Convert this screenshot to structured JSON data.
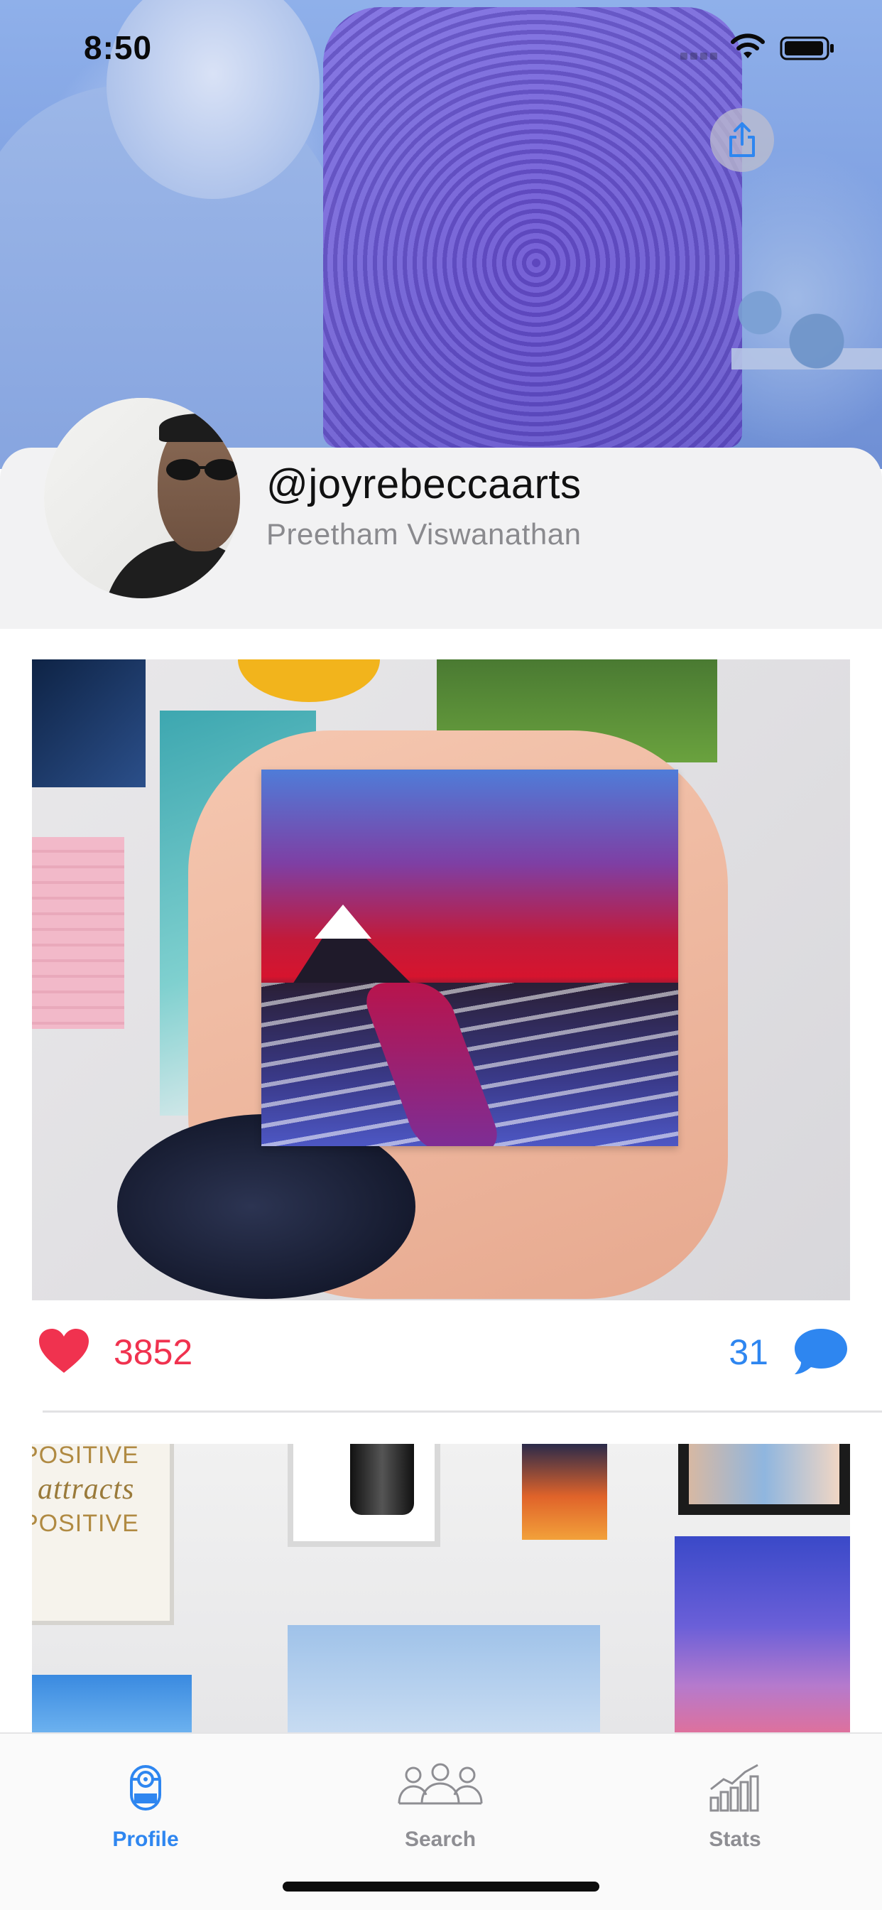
{
  "status_bar": {
    "time": "8:50"
  },
  "profile": {
    "username": "@joyrebeccaarts",
    "full_name": "Preetham Viswanathan"
  },
  "posts": [
    {
      "likes": "3852",
      "comments": "31"
    },
    {
      "sign_text": [
        "POSITIVE",
        "attracts",
        "POSITIVE"
      ]
    }
  ],
  "tab_bar": {
    "tabs": [
      {
        "label": "Profile",
        "icon": "minion-icon",
        "active": true
      },
      {
        "label": "Search",
        "icon": "people-icon",
        "active": false
      },
      {
        "label": "Stats",
        "icon": "chart-icon",
        "active": false
      }
    ]
  },
  "colors": {
    "accent_blue": "#2e86f0",
    "like_red": "#f0324f",
    "tab_inactive": "#8e8e93",
    "card_bg": "#f2f2f3"
  }
}
